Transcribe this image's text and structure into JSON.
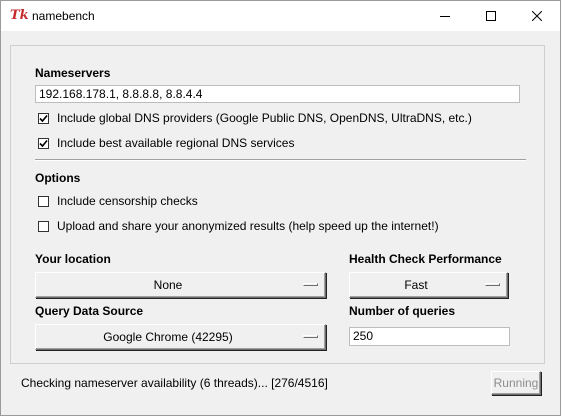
{
  "window": {
    "title": "namebench",
    "icon": "tk-feather-icon",
    "controls": [
      "minimize-icon",
      "maximize-icon",
      "close-icon"
    ]
  },
  "nameservers": {
    "heading": "Nameservers",
    "input_value": "192.168.178.1, 8.8.8.8, 8.8.4.4",
    "include_global": {
      "label": "Include global DNS providers (Google Public DNS, OpenDNS, UltraDNS, etc.)",
      "checked": true
    },
    "include_regional": {
      "label": "Include best available regional DNS services",
      "checked": true
    }
  },
  "options": {
    "heading": "Options",
    "censorship": {
      "label": "Include censorship checks",
      "checked": false
    },
    "upload": {
      "label": "Upload and share your anonymized results (help speed up the internet!)",
      "checked": false
    }
  },
  "location": {
    "heading": "Your location",
    "selected": "None"
  },
  "health_check": {
    "heading": "Health Check Performance",
    "selected": "Fast"
  },
  "query_source": {
    "heading": "Query Data Source",
    "selected": "Google Chrome (42295)"
  },
  "num_queries": {
    "heading": "Number of queries",
    "value": "250"
  },
  "status": {
    "text": "Checking nameserver availability (6 threads)... [276/4516]",
    "button_label": "Running",
    "button_enabled": false
  }
}
